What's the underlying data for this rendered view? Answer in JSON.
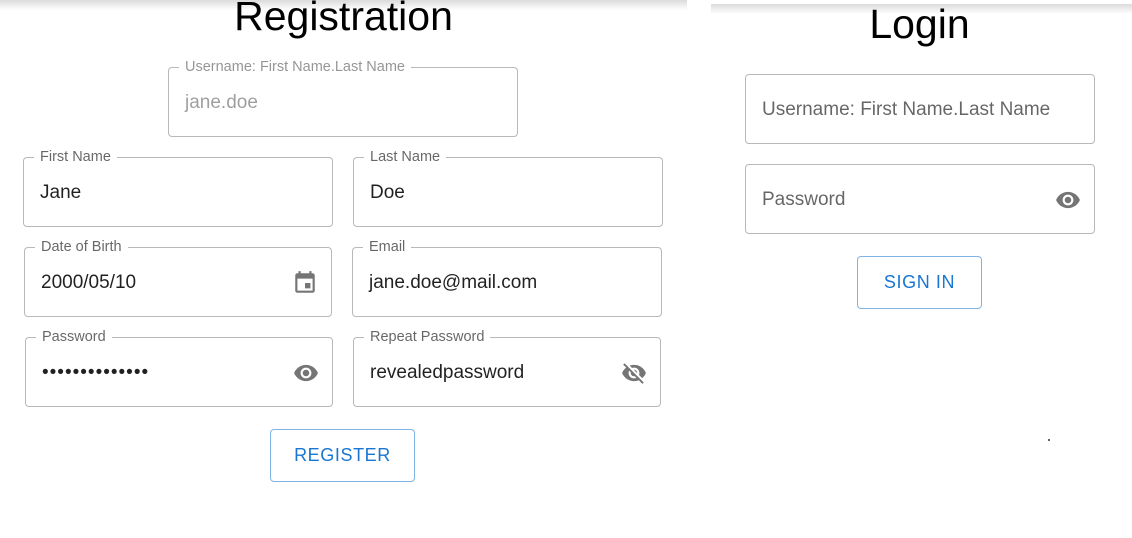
{
  "registration": {
    "title": "Registration",
    "username": {
      "label": "Username: First Name.Last Name",
      "value": "jane.doe"
    },
    "first_name": {
      "label": "First Name",
      "value": "Jane"
    },
    "last_name": {
      "label": "Last Name",
      "value": "Doe"
    },
    "dob": {
      "label": "Date of Birth",
      "value": "2000/05/10",
      "icon": "calendar-icon"
    },
    "email": {
      "label": "Email",
      "value": "jane.doe@mail.com"
    },
    "password": {
      "label": "Password",
      "value": "••••••••••••••",
      "icon": "eye-icon"
    },
    "repeat_password": {
      "label": "Repeat Password",
      "value": "revealedpassword",
      "icon": "eye-off-icon"
    },
    "register_label": "REGISTER"
  },
  "login": {
    "title": "Login",
    "username": {
      "placeholder": "Username: First Name.Last Name"
    },
    "password": {
      "placeholder": "Password",
      "icon": "eye-icon"
    },
    "signin_label": "SIGN IN"
  },
  "colors": {
    "primary": "#1976d2",
    "border": "#c4c4c4",
    "icon": "#757575"
  }
}
